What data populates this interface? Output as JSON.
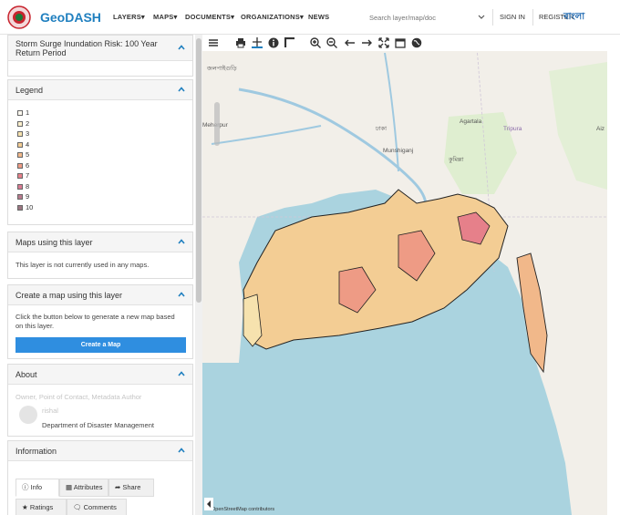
{
  "header": {
    "brand": "GeoDASH",
    "nav": [
      "LAYERS▾",
      "MAPS▾",
      "DOCUMENTS▾",
      "ORGANIZATIONS▾",
      "NEWS"
    ],
    "search_placeholder": "Search layer/map/doc",
    "sign_in": "SIGN IN",
    "register": "REGISTER",
    "language": "বাংলা"
  },
  "sidebar": {
    "title_panel": {
      "title": "Storm Surge Inundation Risk: 100 Year Return Period"
    },
    "legend": {
      "title": "Legend",
      "items": [
        {
          "label": "1",
          "color": "#fff9ef"
        },
        {
          "label": "2",
          "color": "#fbefcc"
        },
        {
          "label": "3",
          "color": "#f6e2ae"
        },
        {
          "label": "4",
          "color": "#f3cd94"
        },
        {
          "label": "5",
          "color": "#f1b88a"
        },
        {
          "label": "6",
          "color": "#ee9b85"
        },
        {
          "label": "7",
          "color": "#e6808a"
        },
        {
          "label": "8",
          "color": "#d97a92"
        },
        {
          "label": "9",
          "color": "#b87a8e"
        },
        {
          "label": "10",
          "color": "#9b7682"
        }
      ]
    },
    "maps_using": {
      "title": "Maps using this layer",
      "text": "This layer is not currently used in any maps."
    },
    "create_map": {
      "title": "Create a map using this layer",
      "text": "Click the button below to generate a new map based on this layer.",
      "button": "Create a Map"
    },
    "about": {
      "title": "About",
      "blurred_line": "Owner, Point of Contact, Metadata Author",
      "owner_name": "rishal",
      "org": "Department of Disaster Management"
    },
    "information": {
      "title": "Information",
      "tabs": [
        "Info",
        "Attributes",
        "Share",
        "Ratings",
        "Comments"
      ]
    }
  },
  "map": {
    "labels": [
      "জলপাইগুড়ি",
      "Meherpur",
      "Agartala",
      "Tripura",
      "Munshiganj",
      "কুমিল্লা",
      "ঢাকা",
      "Aiz"
    ],
    "attribution": "OpenStreetMap contributors",
    "colors": {
      "sea": "#aad3df",
      "land": "#f2efe9",
      "inundation_low": "#f6e2ae",
      "inundation_high": "#e6808a"
    }
  }
}
